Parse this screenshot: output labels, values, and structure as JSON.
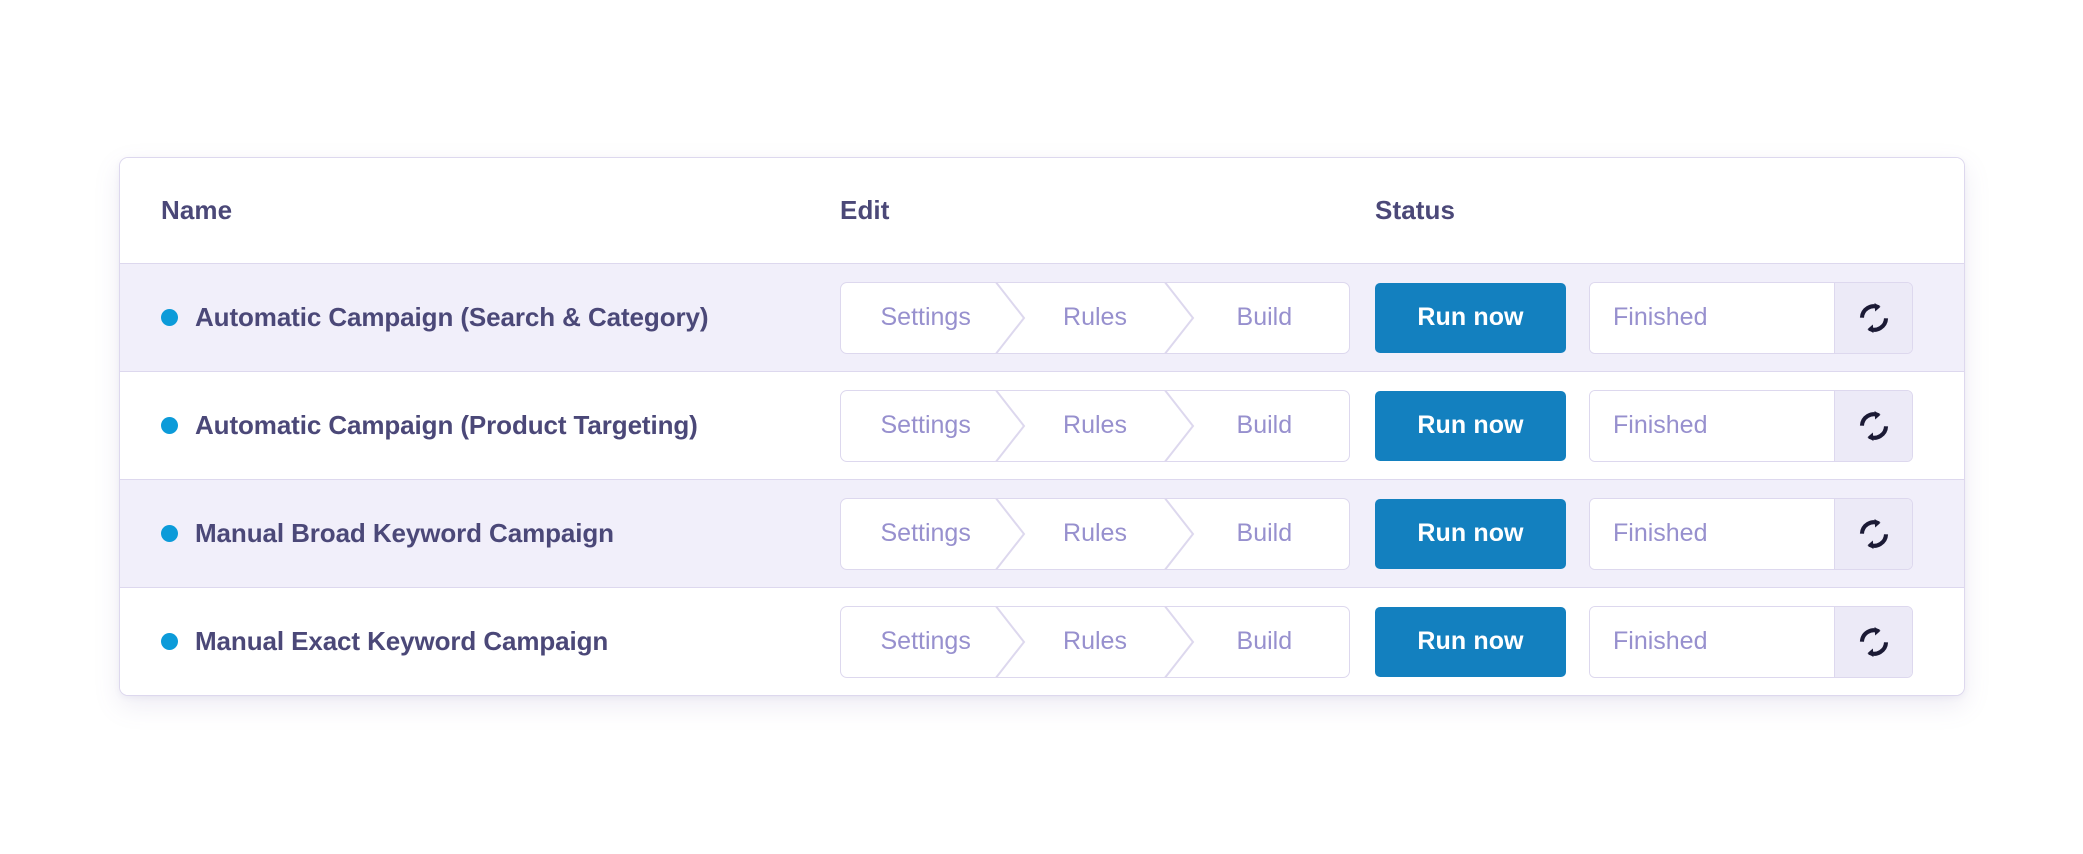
{
  "table": {
    "columns": [
      {
        "key": "name",
        "label": "Name"
      },
      {
        "key": "edit",
        "label": "Edit"
      },
      {
        "key": "status",
        "label": "Status"
      }
    ],
    "steps": [
      "Settings",
      "Rules",
      "Build"
    ],
    "run_label": "Run now",
    "status_value": "Finished",
    "refresh_icon": "refresh-icon",
    "status_dot_icon": "status-dot-icon",
    "rows": [
      {
        "name": "Automatic Campaign (Search & Category)"
      },
      {
        "name": "Automatic Campaign (Product Targeting)"
      },
      {
        "name": "Manual Broad Keyword Campaign"
      },
      {
        "name": "Manual Exact Keyword Campaign"
      }
    ]
  },
  "colors": {
    "accent_blue": "#1380bf",
    "dot_blue": "#0c9bd9",
    "text_indigo": "#4b4878",
    "muted_purple": "#9790ce",
    "border_lavender": "#ddd8ee",
    "row_alt": "#f1effa"
  }
}
